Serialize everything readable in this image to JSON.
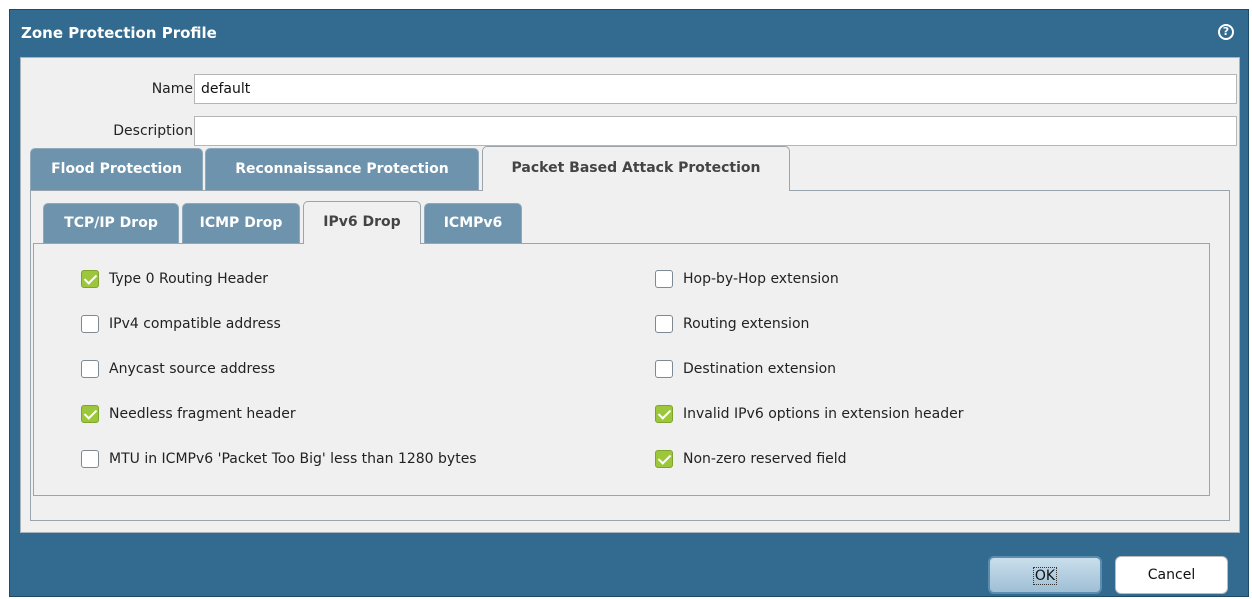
{
  "dialog": {
    "title": "Zone Protection Profile",
    "help_icon": "help-icon"
  },
  "form": {
    "name_label": "Name",
    "name_value": "default",
    "description_label": "Description",
    "description_value": ""
  },
  "tabs": [
    {
      "label": "Flood Protection",
      "active": false
    },
    {
      "label": "Reconnaissance Protection",
      "active": false
    },
    {
      "label": "Packet Based Attack Protection",
      "active": true
    }
  ],
  "subtabs": [
    {
      "label": "TCP/IP Drop",
      "active": false
    },
    {
      "label": "ICMP Drop",
      "active": false
    },
    {
      "label": "IPv6 Drop",
      "active": true
    },
    {
      "label": "ICMPv6",
      "active": false
    }
  ],
  "options_left": [
    {
      "label": "Type 0 Routing Header",
      "checked": true
    },
    {
      "label": "IPv4 compatible address",
      "checked": false
    },
    {
      "label": "Anycast source address",
      "checked": false
    },
    {
      "label": "Needless fragment header",
      "checked": true
    },
    {
      "label": "MTU in ICMPv6 'Packet Too Big' less than 1280 bytes",
      "checked": false
    }
  ],
  "options_right": [
    {
      "label": "Hop-by-Hop extension",
      "checked": false
    },
    {
      "label": "Routing extension",
      "checked": false
    },
    {
      "label": "Destination extension",
      "checked": false
    },
    {
      "label": "Invalid IPv6 options in extension header",
      "checked": true
    },
    {
      "label": "Non-zero reserved field",
      "checked": true
    }
  ],
  "footer": {
    "ok_label": "OK",
    "cancel_label": "Cancel"
  },
  "colors": {
    "title_bar": "#336b90",
    "checkbox_checked": "#9cc73a",
    "tab_inactive": "#6e93ac"
  }
}
